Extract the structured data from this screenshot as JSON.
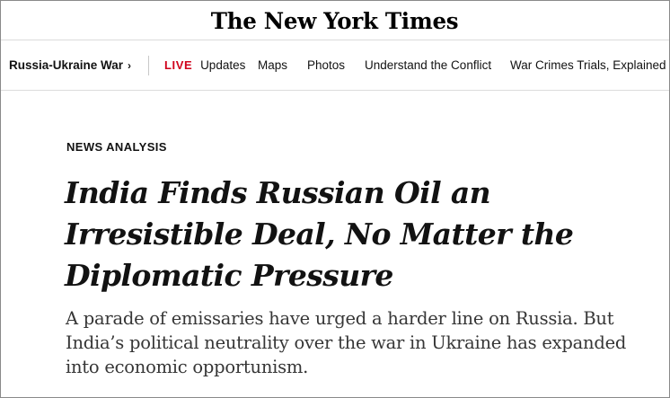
{
  "masthead": {
    "logo_text": "The New York Times"
  },
  "nav": {
    "section_label": "Russia-Ukraine War",
    "chevron": "›",
    "live_badge": "LIVE",
    "items": [
      {
        "label": "Updates"
      },
      {
        "label": "Maps"
      },
      {
        "label": "Photos"
      },
      {
        "label": "Understand the Conflict"
      },
      {
        "label": "War Crimes Trials, Explained"
      }
    ]
  },
  "article": {
    "kicker": "NEWS ANALYSIS",
    "headline": "India Finds Russian Oil an Irresistible Deal, No Matter the Diplomatic Pressure",
    "summary": "A parade of emissaries have urged a harder line on Russia. But India’s political neutrality over the war in Ukraine has expanded into economic opportunism."
  },
  "colors": {
    "live_red": "#d0021b",
    "text": "#121212",
    "summary_text": "#363636",
    "rule": "#dcdcdc",
    "frame": "#8a8a8a"
  }
}
